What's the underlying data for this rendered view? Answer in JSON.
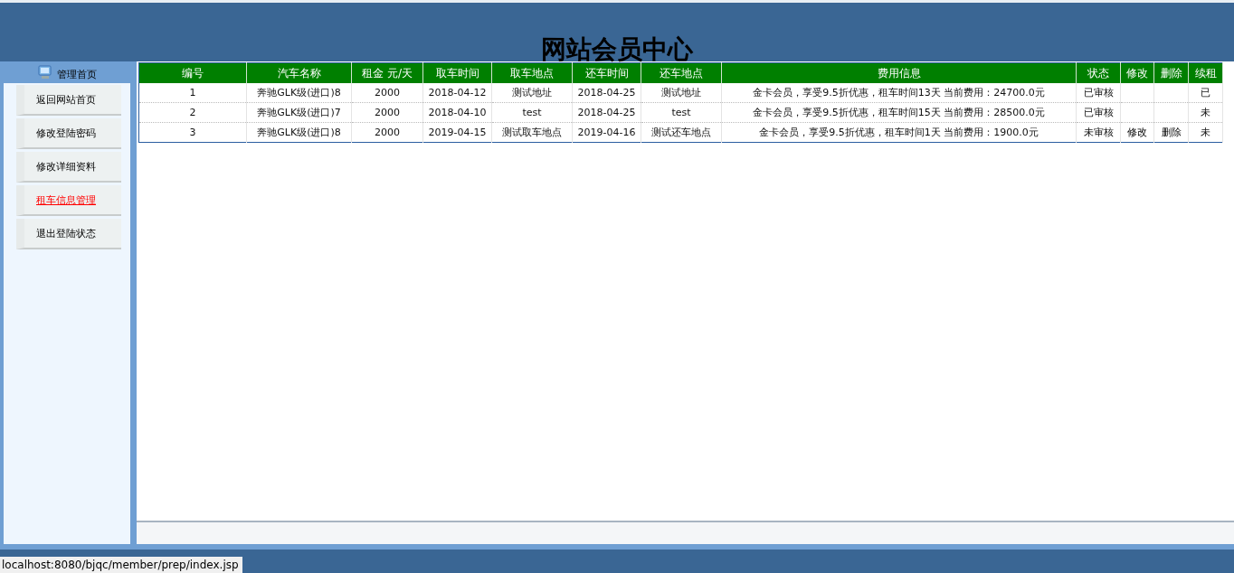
{
  "header": {
    "title": "网站会员中心"
  },
  "sidebar": {
    "heading": "管理首页",
    "items": [
      {
        "label": "返回网站首页",
        "selected": false
      },
      {
        "label": "修改登陆密码",
        "selected": false
      },
      {
        "label": "修改详细资料",
        "selected": false
      },
      {
        "label": "租车信息管理",
        "selected": true
      },
      {
        "label": "退出登陆状态",
        "selected": false
      }
    ]
  },
  "table": {
    "columns": [
      "编号",
      "汽车名称",
      "租金 元/天",
      "取车时间",
      "取车地点",
      "还车时间",
      "还车地点",
      "费用信息",
      "状态",
      "修改",
      "删除",
      "续租"
    ],
    "rows": [
      {
        "id": "1",
        "car": "奔驰GLK级(进口)8",
        "rent": "2000",
        "pickup_time": "2018-04-12",
        "pickup_place": "测试地址",
        "return_time": "2018-04-25",
        "return_place": "测试地址",
        "fee": "金卡会员，享受9.5折优惠，租车时间13天 当前费用：24700.0元",
        "status": "已审核",
        "renewal": "已"
      },
      {
        "id": "2",
        "car": "奔驰GLK级(进口)7",
        "rent": "2000",
        "pickup_time": "2018-04-10",
        "pickup_place": "test",
        "return_time": "2018-04-25",
        "return_place": "test",
        "fee": "金卡会员，享受9.5折优惠，租车时间15天 当前费用：28500.0元",
        "status": "已审核",
        "renewal": "未"
      },
      {
        "id": "3",
        "car": "奔驰GLK级(进口)8",
        "rent": "2000",
        "pickup_time": "2019-04-15",
        "pickup_place": "测试取车地点",
        "return_time": "2019-04-16",
        "return_place": "测试还车地点",
        "fee": "金卡会员，享受9.5折优惠，租车时间1天 当前费用：1900.0元",
        "status": "未审核",
        "edit": "修改",
        "delete": "删除",
        "renewal": "未"
      }
    ]
  },
  "status_bar": {
    "url": "localhost:8080/bjqc/member/prep/index.jsp"
  }
}
